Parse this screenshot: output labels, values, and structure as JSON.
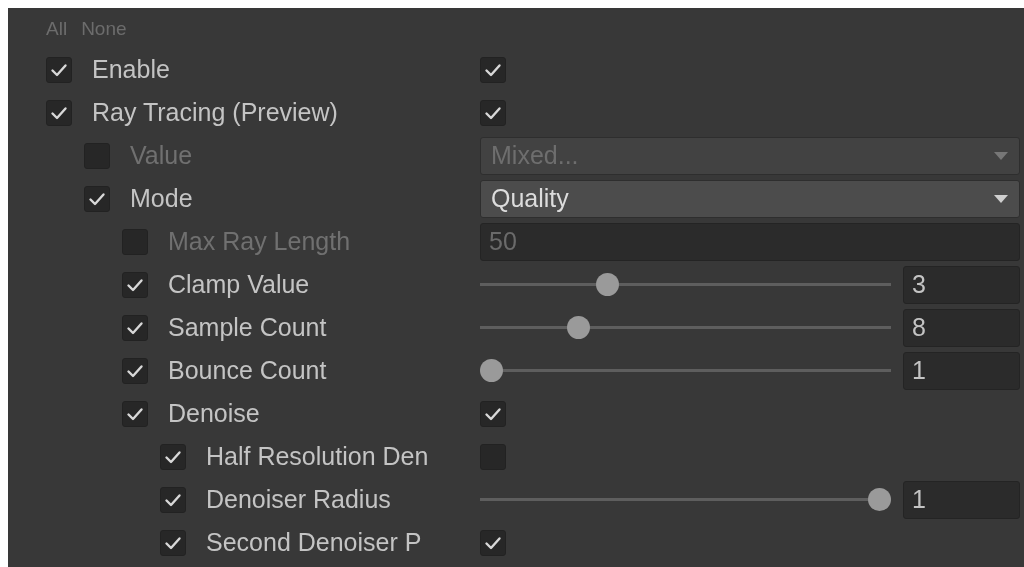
{
  "header": {
    "buttons": [
      "All",
      "None"
    ]
  },
  "properties": [
    {
      "kind": "toggle",
      "label": "Enable",
      "override": true,
      "checked": true
    },
    {
      "kind": "toggle",
      "label": "Ray Tracing (Preview)",
      "override": true,
      "checked": true,
      "children": [
        {
          "kind": "dropdown",
          "label": "Value",
          "override": false,
          "value": "Mixed..."
        },
        {
          "kind": "dropdown",
          "label": "Mode",
          "override": true,
          "value": "Quality",
          "children": [
            {
              "kind": "field",
              "label": "Max Ray Length",
              "override": false,
              "value": "50"
            },
            {
              "kind": "slider",
              "label": "Clamp Value",
              "override": true,
              "level": 0.3,
              "value": "3"
            },
            {
              "kind": "slider",
              "label": "Sample Count",
              "override": true,
              "level": 0.225,
              "value": "8"
            },
            {
              "kind": "slider",
              "label": "Bounce Count",
              "override": true,
              "level": 0,
              "value": "1"
            },
            {
              "kind": "toggle",
              "label": "Denoise",
              "override": true,
              "checked": true,
              "children": [
                {
                  "kind": "toggle",
                  "label": "Half Resolution Den",
                  "override": true,
                  "checked": false
                },
                {
                  "kind": "slider",
                  "label": "Denoiser Radius",
                  "override": true,
                  "level": 1,
                  "value": "1"
                },
                {
                  "kind": "toggle",
                  "label": "Second Denoiser P",
                  "override": true,
                  "checked": true
                }
              ]
            }
          ]
        }
      ]
    }
  ]
}
